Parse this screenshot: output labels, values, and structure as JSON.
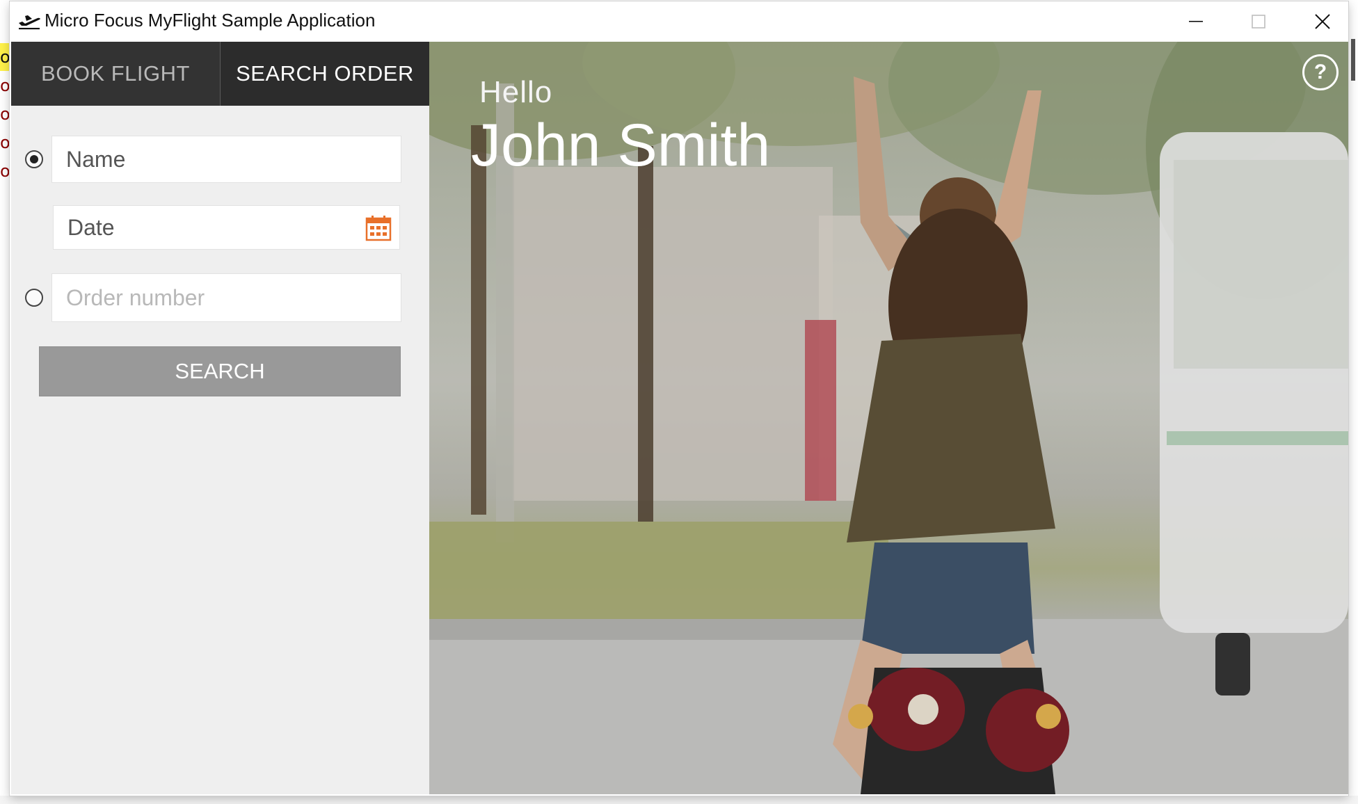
{
  "window": {
    "title": "Micro Focus MyFlight Sample Application",
    "icon": "airplane-takeoff-icon"
  },
  "window_controls": {
    "minimize": "minimize-icon",
    "maximize": "maximize-icon",
    "close": "close-icon"
  },
  "background_window": {
    "glyphs": [
      "o",
      "o",
      "o",
      "o",
      "o"
    ]
  },
  "tabs": [
    {
      "label": "BOOK FLIGHT",
      "active": false
    },
    {
      "label": "SEARCH ORDER",
      "active": true
    }
  ],
  "search_form": {
    "by_name_selected": true,
    "name_value": "Name",
    "date_value": "Date",
    "order_number_placeholder": "Order number",
    "search_label": "SEARCH"
  },
  "greeting": {
    "hello": "Hello",
    "user_name": "John Smith"
  },
  "help": {
    "label": "?"
  },
  "colors": {
    "tab_bar": "#333333",
    "panel_bg": "#efefef",
    "button_bg": "#999999",
    "calendar_accent": "#e8702a"
  }
}
